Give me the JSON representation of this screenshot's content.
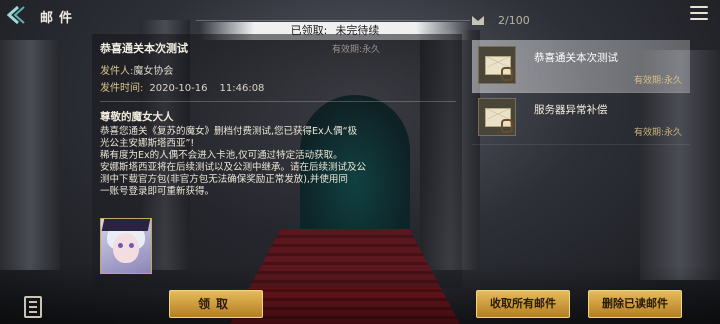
{
  "header": {
    "title": "邮件",
    "counter": "2/100"
  },
  "status_banner": {
    "claimed_label": "已领取:",
    "claimed_value": "未完待续"
  },
  "detail": {
    "subject": "恭喜通关本次测试",
    "validity": "有效期:永久",
    "sender_label": "发件人:",
    "sender": "魔女协会",
    "time_label": "发件时间:",
    "date": "2020-10-16",
    "time": "11:46:08",
    "greeting": "尊敬的魔女大人",
    "body_lines": [
      "恭喜您通关《复苏的魔女》删档付费测试,您已获得Ex人偶“极",
      "光公主安娜斯塔西亚”!",
      "稀有度为Ex的人偶不会进入卡池,仅可通过特定活动获取。",
      "安娜斯塔西亚将在后续测试以及公测中继承。请在后续测试及公",
      "测中下载官方包(非官方包无法确保奖励正常发放),并使用同",
      "一账号登录即可重新获得。"
    ],
    "claim_button": "领取"
  },
  "mail_list": [
    {
      "title": "恭喜通关本次测试",
      "validity": "有效期:永久",
      "selected": true
    },
    {
      "title": "服务器异常补偿",
      "validity": "有效期:永久",
      "selected": false
    }
  ],
  "buttons": {
    "claim_all": "收取所有邮件",
    "delete_read": "删除已读邮件"
  },
  "icons": [
    "back-arrow-icon",
    "menu-icon",
    "envelope-icon",
    "mail-with-attachment-icon",
    "notes-icon"
  ]
}
